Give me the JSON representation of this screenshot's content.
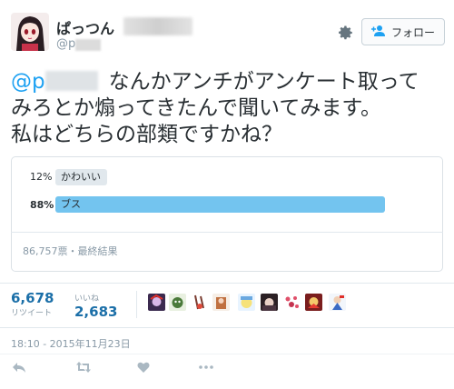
{
  "header": {
    "display_name": "ぱっつん",
    "handle": "@p",
    "follow_label": "フォロー"
  },
  "tweet": {
    "mention": "@p",
    "line1_rest": "なんかアンチがアンケート取って",
    "line2": "みろとか煽ってきたんで聞いてみます。",
    "line3": "私はどちらの部類ですかね？"
  },
  "poll": {
    "options": [
      {
        "label": "かわいい",
        "percent_text": "12%",
        "percent": 12,
        "winner": false
      },
      {
        "label": "ブス",
        "percent_text": "88%",
        "percent": 88,
        "winner": true
      }
    ],
    "meta": "86,757票・最終結果"
  },
  "stats": {
    "retweets": {
      "value": "6,678",
      "label": "リツイート"
    },
    "likes": {
      "value": "2,683",
      "label": "いいね"
    }
  },
  "liker_avatars": [
    "avatar-1",
    "avatar-2",
    "avatar-3",
    "avatar-4",
    "avatar-5",
    "avatar-6",
    "avatar-7",
    "avatar-8",
    "avatar-9"
  ],
  "timestamp": "18:10 - 2015年11月23日",
  "actions": [
    "reply-icon",
    "retweet-icon",
    "like-icon",
    "more-icon"
  ],
  "colors": {
    "link": "#1da1f2",
    "winner_bar": "#73c4ef",
    "loser_bar": "#e1e8ed",
    "stat_number": "#1b6fa8"
  }
}
